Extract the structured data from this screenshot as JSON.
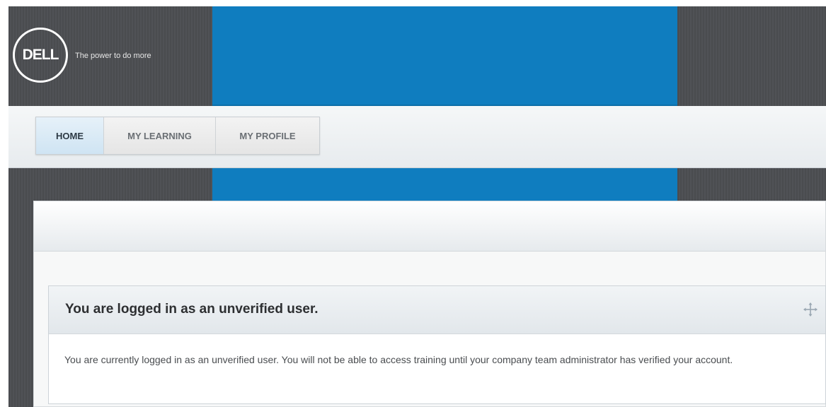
{
  "header": {
    "logo_text": "DELL",
    "tagline": "The power to do more"
  },
  "nav": {
    "items": [
      {
        "label": "HOME",
        "active": true
      },
      {
        "label": "MY LEARNING",
        "active": false
      },
      {
        "label": "MY PROFILE",
        "active": false
      }
    ]
  },
  "notice": {
    "title": "You are logged in as an unverified user.",
    "message": "You are currently logged in as an unverified user. You will not be able to access training until your company team administrator has verified your account.",
    "icon": "move-icon"
  },
  "colors": {
    "brand_blue": "#0f7dbf",
    "header_dark": "#4d4f52",
    "nav_active": "#d8eaf6"
  }
}
